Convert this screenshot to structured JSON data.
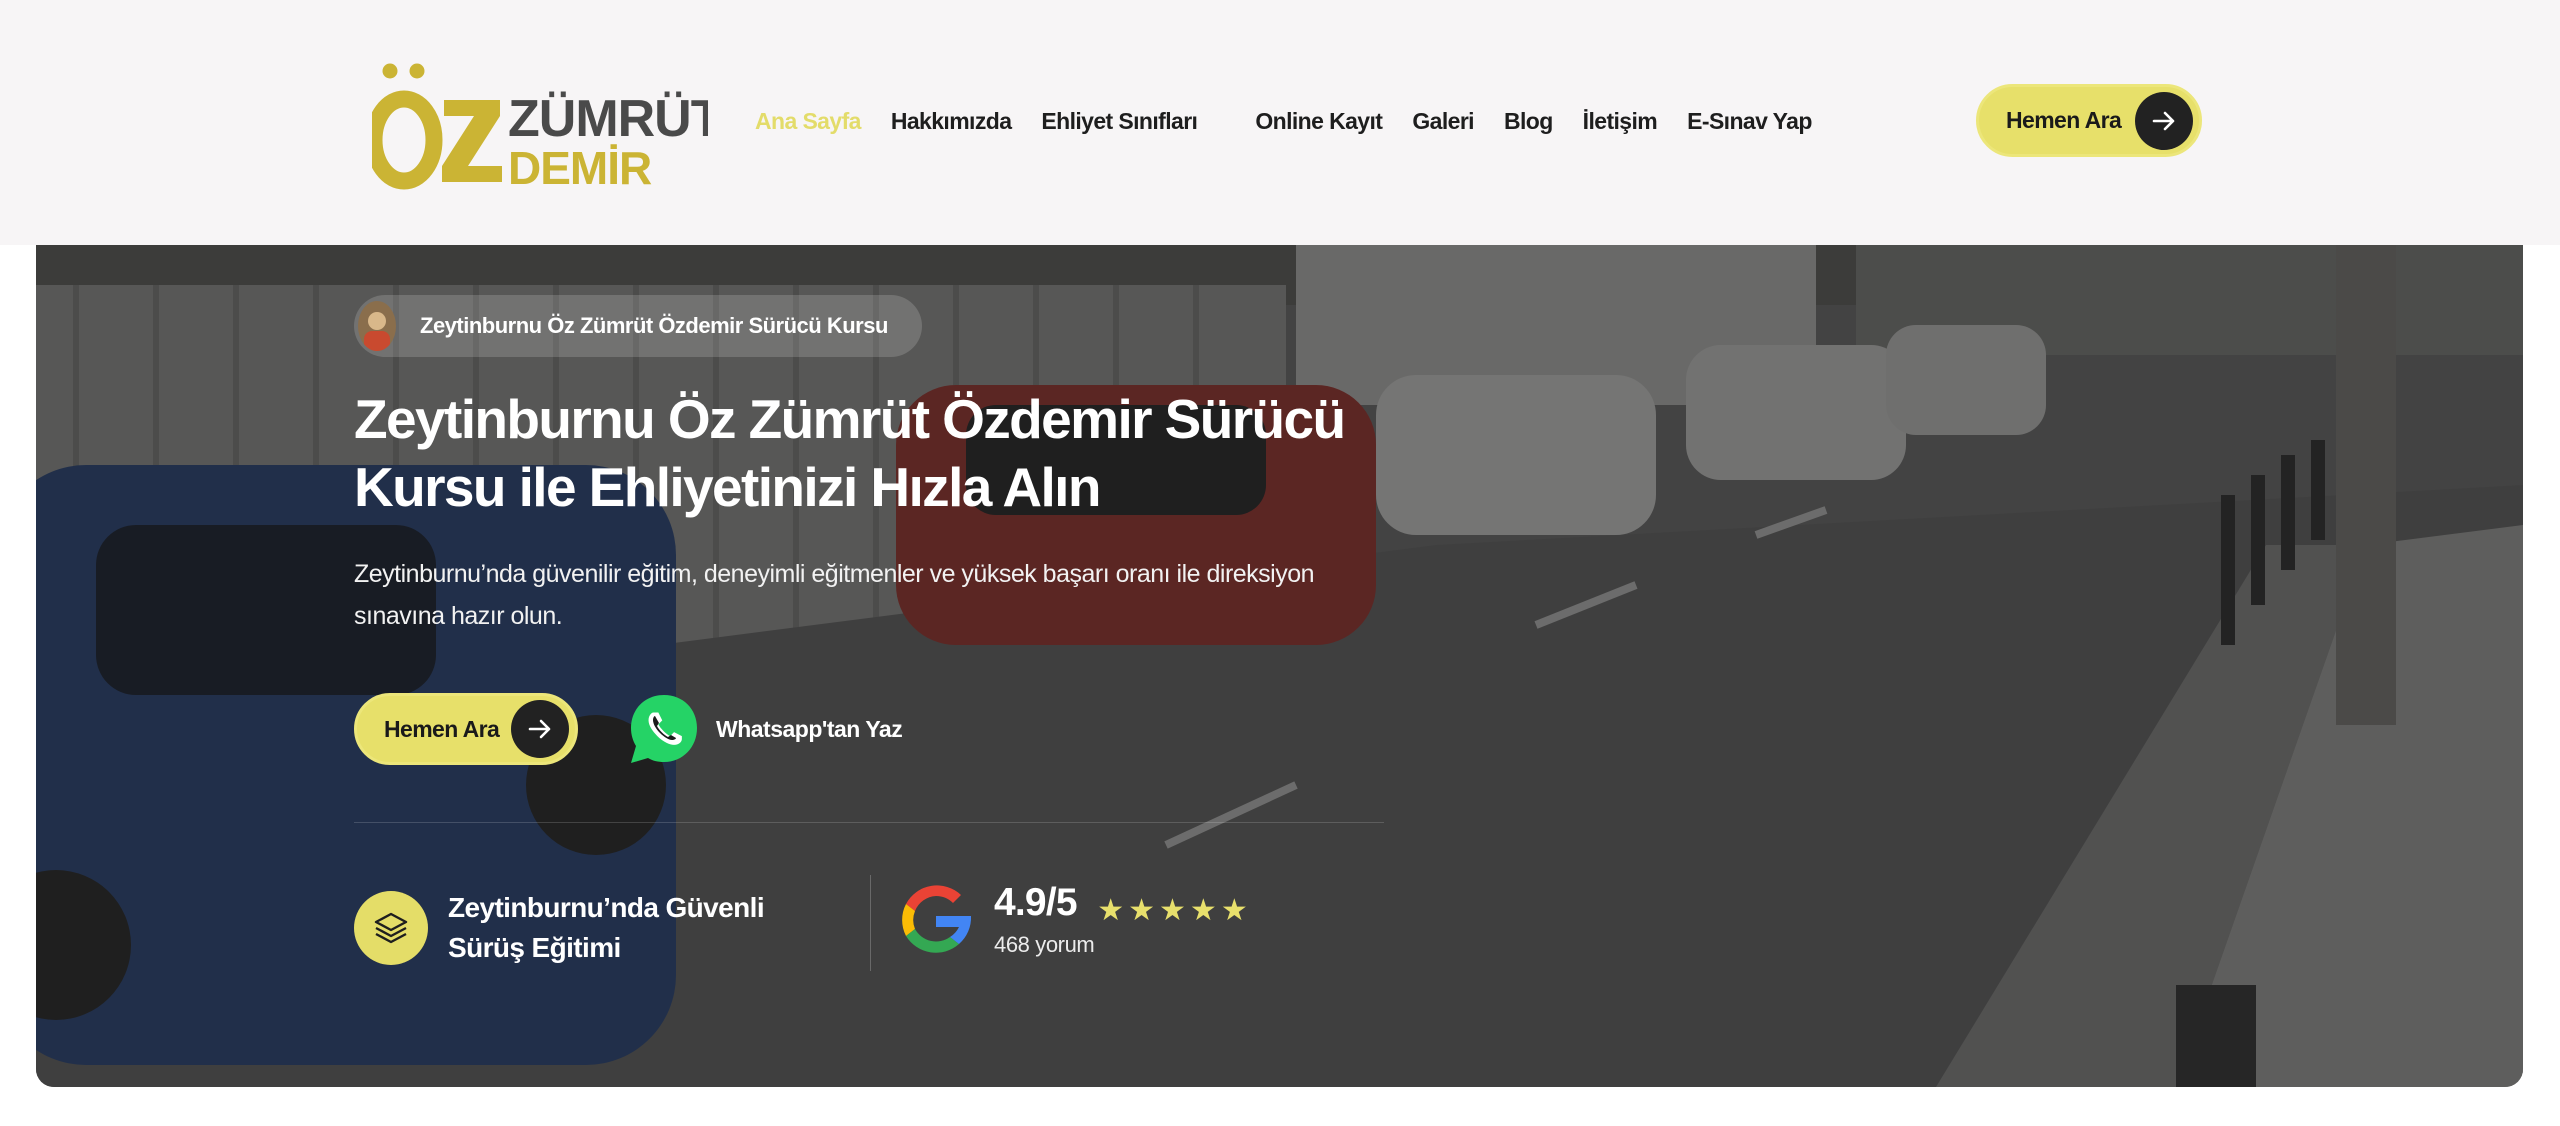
{
  "brand": {
    "logo_line1": "ÖZ",
    "logo_line2": "ZÜMRÜT",
    "logo_line3": "DEMİR",
    "gold": "#cbb434",
    "gray": "#4a4a4a"
  },
  "nav": {
    "items": [
      {
        "label": "Ana Sayfa",
        "active": true
      },
      {
        "label": "Hakkımızda"
      },
      {
        "label": "Ehliyet Sınıfları"
      },
      {
        "label": "Online Kayıt"
      },
      {
        "label": "Galeri"
      },
      {
        "label": "Blog"
      },
      {
        "label": "İletişim"
      },
      {
        "label": "E-Sınav Yap"
      }
    ],
    "cta_label": "Hemen Ara",
    "cta_icon": "arrow-right-icon"
  },
  "hero": {
    "badge_text": "Zeytinburnu Öz Zümrüt Özdemir Sürücü Kursu",
    "title": "Zeytinburnu Öz Zümrüt Özdemir Sürücü Kursu ile Ehliyetinizi Hızla Alın",
    "description": "Zeytinburnu’nda güvenilir eğitim, deneyimli eğitmenler ve yüksek başarı oranı ile direksiyon sınavına hazır olun.",
    "cta_label": "Hemen Ara",
    "whatsapp_label": "Whatsapp'tan Yaz",
    "whatsapp_icon": "whatsapp-icon",
    "feature_text": "Zeytinburnu’nda Güvenli Sürüş Eğitimi",
    "feature_icon": "layers-icon",
    "rating_score": "4.9/5",
    "rating_stars": 5,
    "rating_count": "468 yorum",
    "rating_icon": "google-icon"
  },
  "colors": {
    "accent": "#e7e06a",
    "active_nav": "#e3dc6a",
    "whatsapp": "#25d366",
    "dark": "#222222"
  }
}
